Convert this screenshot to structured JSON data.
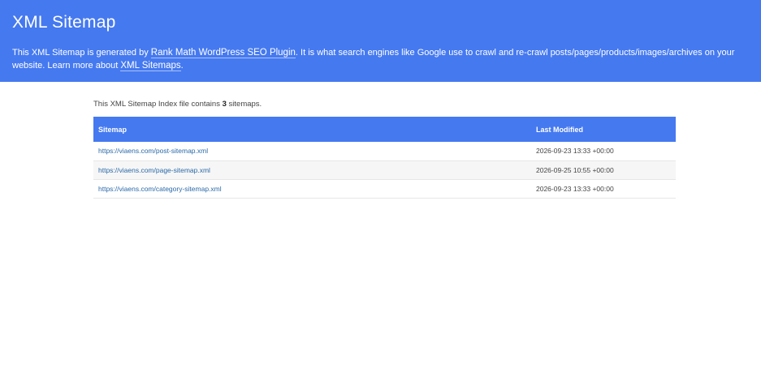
{
  "header": {
    "title": "XML Sitemap",
    "desc_prefix": "This XML Sitemap is generated by ",
    "plugin_link": "Rank Math WordPress SEO Plugin",
    "desc_middle": ". It is what search engines like Google use to crawl and re-crawl posts/pages/products/images/archives on your website. Learn more about ",
    "learn_link": "XML Sitemaps",
    "desc_suffix": ".",
    "background_color": "#4579f0"
  },
  "summary": {
    "prefix": "This XML Sitemap Index file contains ",
    "count": "3",
    "suffix": " sitemaps."
  },
  "table": {
    "columns": [
      "Sitemap",
      "Last Modified"
    ],
    "rows": [
      {
        "url": "https://viaens.com/post-sitemap.xml",
        "modified": "2026-09-23 13:33 +00:00"
      },
      {
        "url": "https://viaens.com/page-sitemap.xml",
        "modified": "2026-09-25 10:55 +00:00"
      },
      {
        "url": "https://viaens.com/category-sitemap.xml",
        "modified": "2026-09-23 13:33 +00:00"
      }
    ],
    "header_color": "#4579f0",
    "link_color": "#2a6aa8"
  }
}
